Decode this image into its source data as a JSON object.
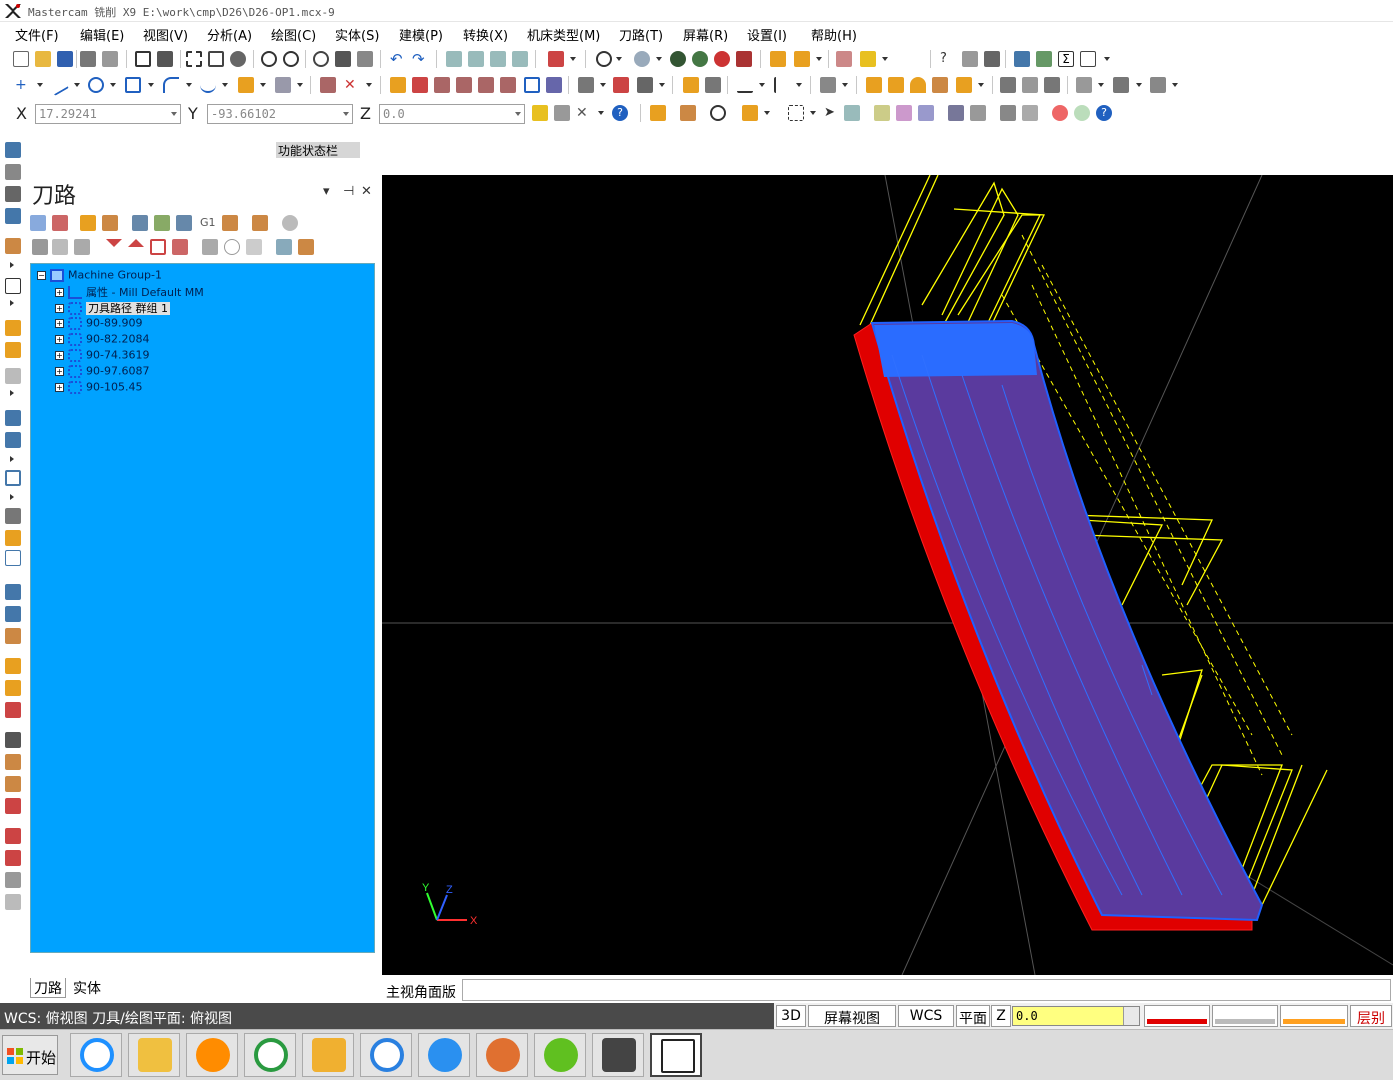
{
  "window": {
    "title": "Mastercam 铣削 X9  E:\\work\\cmp\\D26\\D26-OP1.mcx-9"
  },
  "menu": [
    "文件(F)",
    "编辑(E)",
    "视图(V)",
    "分析(A)",
    "绘图(C)",
    "实体(S)",
    "建模(P)",
    "转换(X)",
    "机床类型(M)",
    "刀路(T)",
    "屏幕(R)",
    "设置(I)",
    "帮助(H)"
  ],
  "coords": {
    "x_label": "X",
    "x_value": "17.29241",
    "y_label": "Y",
    "y_value": "-93.66102",
    "z_label": "Z",
    "z_value": "0.0"
  },
  "status_label": "功能状态栏",
  "panel": {
    "title": "刀路",
    "pin": "▾ ⊣ ✕",
    "tree": [
      {
        "label": "Machine Group-1",
        "icon": "machine-group-icon",
        "color": "#1b4fd8"
      },
      {
        "label": "属性 - Mill Default MM",
        "icon": "properties-icon",
        "color": "#1b4fd8"
      },
      {
        "label": "刀具路径 群组 1",
        "icon": "toolpath-group-icon",
        "color": "#1b4fd8"
      },
      {
        "label": "90-89.909",
        "icon": "operation-icon",
        "color": "#1b4fd8"
      },
      {
        "label": "90-82.2084",
        "icon": "operation-icon",
        "color": "#1b4fd8"
      },
      {
        "label": "90-74.3619",
        "icon": "operation-icon",
        "color": "#1b4fd8"
      },
      {
        "label": "90-97.6087",
        "icon": "operation-icon",
        "color": "#1b4fd8"
      },
      {
        "label": "90-105.45",
        "icon": "operation-icon",
        "color": "#1b4fd8"
      }
    ],
    "tabs": [
      "刀路",
      "实体"
    ]
  },
  "viewport": {
    "background": "#000000",
    "axis_labels": {
      "x": "X",
      "y": "Y",
      "z": "Z"
    },
    "view_label": "主视角面版"
  },
  "statusbar": {
    "info": "WCS: 俯视图   刀具/绘图平面: 俯视图",
    "btn_3d": "3D",
    "btn_screen_view": "屏幕视图",
    "btn_wcs": "WCS",
    "btn_plane": "平面",
    "z_label": "Z",
    "z_value": "0.0",
    "btn_layer": "层别",
    "z_field_color": "#ffff80"
  },
  "taskbar": {
    "start_label": "开始",
    "apps": [
      "ie-icon",
      "explorer-icon",
      "orange-icon",
      "player-icon",
      "box-icon",
      "cloud-icon",
      "video-icon",
      "fox-icon",
      "plus-icon",
      "mastercam-icon",
      "ggg-icon"
    ]
  }
}
